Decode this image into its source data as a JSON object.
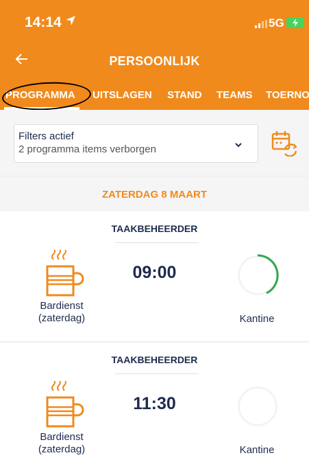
{
  "status": {
    "time": "14:14",
    "network": "5G"
  },
  "header": {
    "title": "PERSOONLIJK"
  },
  "tabs": [
    "PROGRAMMA",
    "UITSLAGEN",
    "STAND",
    "TEAMS",
    "TOERNO"
  ],
  "filters": {
    "title": "Filters actief",
    "subtitle": "2 programma items verborgen"
  },
  "date": "ZATERDAG 8 MAART",
  "items": [
    {
      "role": "TAAKBEHEERDER",
      "time": "09:00",
      "label_line1": "Bardienst",
      "label_line2": "(zaterdag)",
      "location": "Kantine",
      "progress": 0.4
    },
    {
      "role": "TAAKBEHEERDER",
      "time": "11:30",
      "label_line1": "Bardienst",
      "label_line2": "(zaterdag)",
      "location": "Kantine",
      "progress": 0
    }
  ],
  "colors": {
    "accent": "#f08a1c",
    "text": "#1d2b4e",
    "progress": "#2ea84a"
  }
}
